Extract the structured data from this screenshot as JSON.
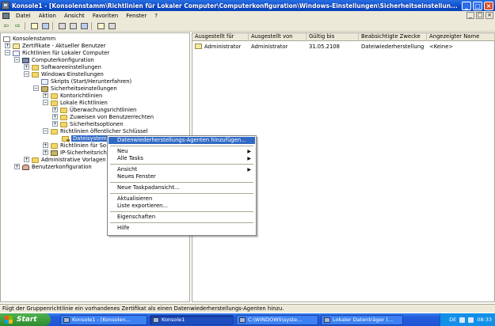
{
  "window": {
    "title": "Konsole1 - [Konsolenstamm\\Richtlinien für Lokaler Computer\\Computerkonfiguration\\Windows-Einstellungen\\Sicherheitseinstellun...",
    "min": "_",
    "max": "□",
    "close": "×"
  },
  "menubar": {
    "items": [
      "Datei",
      "Aktion",
      "Ansicht",
      "Favoriten",
      "Fenster",
      "?"
    ],
    "mdi_min": "_",
    "mdi_max": "□",
    "mdi_close": "×"
  },
  "toolbar": {
    "back": "⇦",
    "forward": "⇨"
  },
  "tree": {
    "root": "Konsolenstamm",
    "certs_user": "Zertifikate - Aktueller Benutzer",
    "local_policy": "Richtlinien für Lokaler Computer",
    "computer_config": "Computerkonfiguration",
    "software_settings": "Softwareeinstellungen",
    "windows_settings": "Windows-Einstellungen",
    "scripts": "Skripts (Start/Herunterfahren)",
    "security_settings": "Sicherheitseinstellungen",
    "account_policies": "Kontorichtlinien",
    "local_policies": "Lokale Richtlinien",
    "audit_policies": "Überwachungsrichtlinien",
    "user_rights": "Zuweisen von Benutzerrechten",
    "security_options": "Sicherheitsoptionen",
    "public_key_policies": "Richtlinien öffentlicher Schlüssel",
    "efs": "Dateisystem",
    "software_restriction": "Richtlinien für So",
    "ip_security": "IP-Sicherheitsricht",
    "admin_templates": "Administrative Vorlagen",
    "user_config": "Benutzerkonfiguration"
  },
  "list": {
    "columns": [
      "Ausgestellt für",
      "Ausgestellt von",
      "Gültig bis",
      "Beabsichtigte Zwecke",
      "Angezeigter Name"
    ],
    "rows": [
      [
        "Administrator",
        "Administrator",
        "31.05.2108",
        "Dateiwiederherstellung",
        "<Keine>"
      ]
    ]
  },
  "context_menu": {
    "add_agent": "Datenwiederherstellungs-Agenten hinzufügen...",
    "new": "Neu",
    "all_tasks": "Alle Tasks",
    "view": "Ansicht",
    "new_window": "Neues Fenster",
    "new_taskpad": "Neue Taskpadansicht...",
    "refresh": "Aktualisieren",
    "export_list": "Liste exportieren...",
    "properties": "Eigenschaften",
    "help": "Hilfe",
    "submenu_arrow": "▶"
  },
  "statusbar": {
    "text": "Fügt der Gruppenrichtlinie ein vorhandenes Zertifikat als einen Datenwiederherstellungs-Agenten hinzu."
  },
  "taskbar": {
    "start": "Start",
    "tasks": [
      "Konsole1 - [Konsolen...",
      "Konsole1",
      "C:\\WINDOWS\\syste...",
      "Lokaler Datenträger (..."
    ],
    "lang": "DE",
    "clock": "08:33"
  },
  "colors": {
    "selection": "#316ac5",
    "titlebar": "#0a4ccf",
    "taskbar": "#245edc",
    "start_button": "#2f8a2f",
    "chrome": "#ece9d8"
  }
}
